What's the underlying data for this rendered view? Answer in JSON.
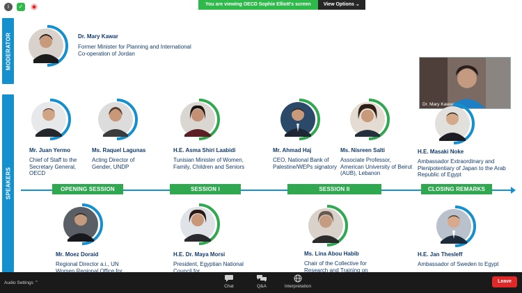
{
  "topbar": {
    "share_banner": "You are viewing OECD Sophie Elliott's screen",
    "view_options": "View Options ⌄"
  },
  "labels": {
    "moderator": "MODERATOR",
    "speakers": "SPEAKERS"
  },
  "moderator": {
    "name": "Dr. Mary Kawar",
    "role": "Former Minister for Planning and International Co-operation of Jordan"
  },
  "speakers": [
    {
      "name": "Mr. Juan Yermo",
      "role": "Chief of Staff to the Secretary General, OECD"
    },
    {
      "name": "Ms. Raquel Lagunas",
      "role": "Acting Director of Gender, UNDP"
    },
    {
      "name": "H.E. Asma Shiri Laabidi",
      "role": "Tunisian Minister of Women, Family, Children and Seniors"
    },
    {
      "name": "Mr. Ahmad Haj",
      "role": "CEO, National Bank of Palestine/WEPs signatory"
    },
    {
      "name": "Ms. Nisreen Salti",
      "role": "Associate Professor, American University of Beirut (AUB), Lebanon"
    },
    {
      "name": "H.E. Masaki Noke",
      "role": "Ambassador Extraordinary and Plenipotentiary of Japan to the Arab Republic of Egypt"
    },
    {
      "name": "Mr. Moez Doraid",
      "role": "Regional Director a.i., UN Women Regional Office for"
    },
    {
      "name": "H.E. Dr. Maya Morsi",
      "role": "President, Egyptian National Council for"
    },
    {
      "name": "Ms. Lina Abou Habib",
      "role": "Chair of the Collective for Research and Training on"
    },
    {
      "name": "H.E. Jan Thesleff",
      "role": "Ambassador of Sweden to Egypt"
    }
  ],
  "sessions": [
    "OPENING SESSION",
    "SESSION I",
    "SESSION II",
    "CLOSING REMARKS"
  ],
  "video": {
    "label": "Dr. Mary Kawar"
  },
  "bottombar": {
    "audio": "Audio Settings ⌃",
    "chat": "Chat",
    "qa": "Q&A",
    "interpretation": "Interpretation",
    "leave": "Leave"
  },
  "colors": {
    "accent": "#1590cf",
    "session": "#2fa84f",
    "name_text": "#123b6d"
  }
}
